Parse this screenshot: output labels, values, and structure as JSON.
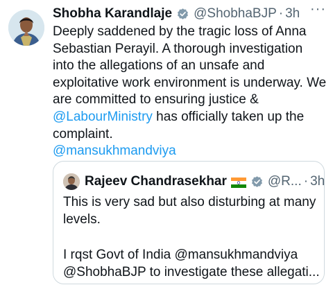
{
  "tweet": {
    "author_name": "Shobha Karandlaje",
    "handle": "@ShobhaBJP",
    "separator": "·",
    "time": "3h",
    "more_label": "···",
    "text_before": "Deeply saddened by the tragic loss of Anna Sebastian Perayil. A thorough investigation into the allegations of an unsafe and exploitative work environment is underway. We are committed to ensuring justice & ",
    "mention_1": "@LabourMinistry",
    "text_after": " has officially taken up the complaint.",
    "mention_2": "@mansukhmandviya"
  },
  "quoted": {
    "author_name": "Rajeev Chandrasekhar",
    "flag_icon": "india-flag-icon",
    "handle": "@R...",
    "separator": "·",
    "time": "3h",
    "line_1": "This is very sad but also disturbing at many levels.",
    "line_2": "I rqst Govt of India @mansukhmandviya @ShobhaBJP to investigate these allegati..."
  },
  "colors": {
    "text": "#0f1419",
    "secondary": "#536471",
    "link": "#1d9bf0",
    "border": "#cfd9de",
    "verified": "#829aab"
  }
}
